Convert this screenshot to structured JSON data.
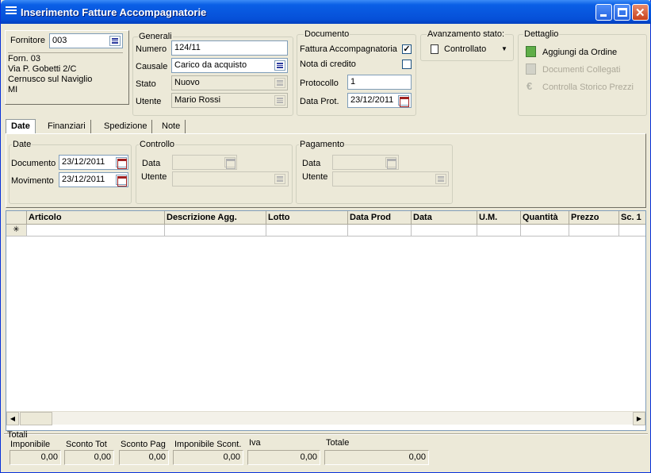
{
  "window": {
    "title": "Inserimento Fatture Accompagnatorie"
  },
  "fornitore": {
    "label": "Fornitore",
    "value": "003",
    "address": [
      "Forn. 03",
      "Via P. Gobetti 2/C",
      "Cernusco sul Naviglio",
      "MI"
    ]
  },
  "generali": {
    "legend": "Generali",
    "numero_label": "Numero",
    "numero": "124/11",
    "causale_label": "Causale",
    "causale": "Carico da acquisto",
    "stato_label": "Stato",
    "stato": "Nuovo",
    "utente_label": "Utente",
    "utente": "Mario Rossi"
  },
  "documento": {
    "legend": "Documento",
    "fattura_acc_label": "Fattura Accompagnatoria",
    "fattura_acc_checked": "✓",
    "nota_credito_label": "Nota di credito",
    "protocollo_label": "Protocollo",
    "protocollo": "1",
    "data_prot_label": "Data Prot.",
    "data_prot": "23/12/2011"
  },
  "avanzamento": {
    "legend": "Avanzamento stato:",
    "value": "Controllato"
  },
  "dettaglio": {
    "legend": "Dettaglio",
    "items": [
      "Aggiungi da Ordine",
      "Documenti Collegati",
      "Controlla Storico Prezzi"
    ]
  },
  "tabs": [
    "Date",
    "Finanziari",
    "Spedizione",
    "Note"
  ],
  "date_tab": {
    "date_legend": "Date",
    "documento_label": "Documento",
    "documento": "23/12/2011",
    "movimento_label": "Movimento",
    "movimento": "23/12/2011",
    "controllo_legend": "Controllo",
    "pagamento_legend": "Pagamento",
    "data_label": "Data",
    "utente_label": "Utente"
  },
  "grid": {
    "columns": [
      "Articolo",
      "Descrizione Agg.",
      "Lotto",
      "Data Prod",
      "Data",
      "U.M.",
      "Quantità",
      "Prezzo",
      "Sc. 1"
    ],
    "new_row_marker": "✳"
  },
  "totali": {
    "legend": "Totali",
    "labels": [
      "Imponibile",
      "Sconto Tot",
      "Sconto Pag",
      "Imponibile Scont.",
      "Iva",
      "Totale"
    ],
    "values": [
      "0,00",
      "0,00",
      "0,00",
      "0,00",
      "0,00",
      "0,00"
    ]
  }
}
